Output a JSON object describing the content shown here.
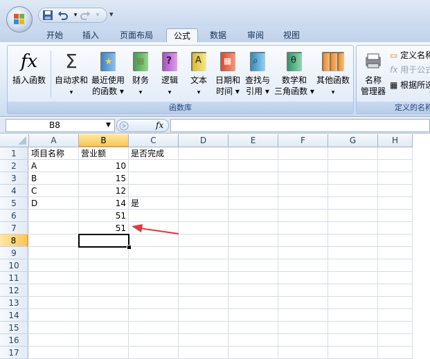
{
  "qat": {
    "save_icon": "save-icon",
    "undo_icon": "undo-icon",
    "redo_icon": "redo-icon",
    "customize_glyph": "▾"
  },
  "tabs": [
    "开始",
    "插入",
    "页面布局",
    "公式",
    "数据",
    "审阅",
    "视图"
  ],
  "active_tab": "公式",
  "ribbon": {
    "function_library": {
      "label": "函数库",
      "insert_function": "插入函数",
      "autosum": [
        "自动求和",
        "▾"
      ],
      "recent": [
        "最近使用",
        "的函数 ▾"
      ],
      "financial": [
        "财务",
        "▾"
      ],
      "logical": [
        "逻辑",
        "▾"
      ],
      "text": [
        "文本",
        "▾"
      ],
      "datetime": [
        "日期和",
        "时间 ▾"
      ],
      "lookup": [
        "查找与",
        "引用 ▾"
      ],
      "math": [
        "数学和",
        "三角函数 ▾"
      ],
      "more": [
        "其他函数",
        "▾"
      ]
    },
    "defined_names": {
      "label": "定义的名称",
      "name_manager": [
        "名称",
        "管理器"
      ],
      "define_name": "定义名称",
      "use_in_formula": "用于公式",
      "create_from_selection": "根据所选"
    }
  },
  "formula_bar": {
    "name_box": "B8",
    "dropdown": "▼",
    "fx": "fx",
    "formula": ""
  },
  "grid": {
    "columns": [
      "A",
      "B",
      "C",
      "D",
      "E",
      "F",
      "G",
      "H"
    ],
    "selected_column": "B",
    "rows": [
      "1",
      "2",
      "3",
      "4",
      "5",
      "6",
      "7",
      "8",
      "9",
      "10",
      "11",
      "12",
      "13",
      "14",
      "15",
      "16",
      "17"
    ],
    "selected_row": "8",
    "cells": {
      "A1": "项目名称",
      "B1": "营业额",
      "C1": "是否完成",
      "A2": "A",
      "B2": "10",
      "A3": "B",
      "B3": "15",
      "A4": "C",
      "B4": "12",
      "A5": "D",
      "B5": "14",
      "C5": "是",
      "B6": "51",
      "B7": "51"
    },
    "numeric_cells": [
      "B2",
      "B3",
      "B4",
      "B5",
      "B6",
      "B7"
    ]
  },
  "annotation": {
    "arrow_color": "#e03a3a"
  },
  "colors": {
    "selection_header": "#f9c659",
    "ribbon_blue": "#dbe7f5"
  }
}
